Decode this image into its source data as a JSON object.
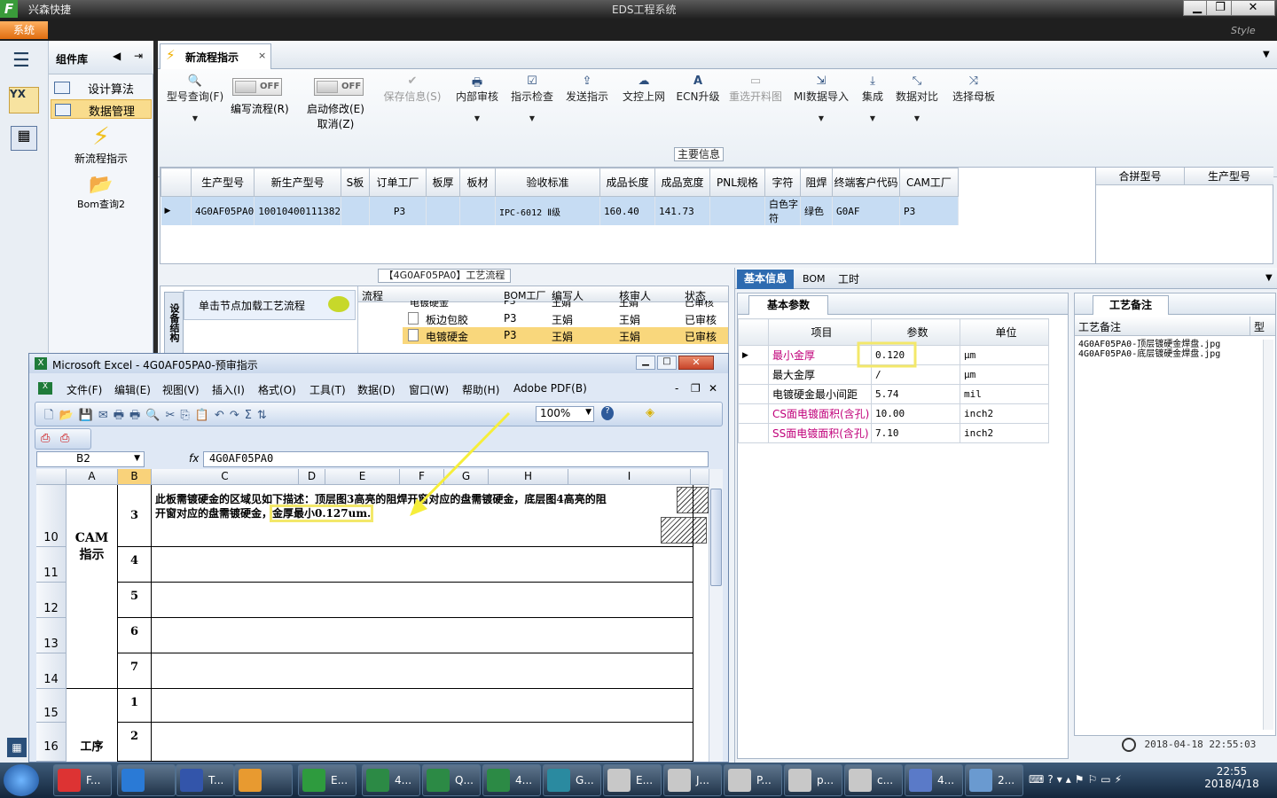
{
  "window": {
    "app_name": "兴森快捷",
    "title": "EDS工程系统",
    "system_label": "系统",
    "style_label": "Style"
  },
  "sidebar": {
    "header": "组件库",
    "items": [
      {
        "label": "设计算法"
      },
      {
        "label": "数据管理"
      }
    ],
    "big_items": [
      {
        "label": "新流程指示"
      },
      {
        "label": "Bom查询2"
      }
    ]
  },
  "tabs": [
    {
      "label": "新流程指示"
    }
  ],
  "ribbon": {
    "buttons": [
      {
        "label": "型号查询(F)",
        "icon": "search-icon"
      },
      {
        "label": "保存信息(S)",
        "icon": "check-icon",
        "disabled": true
      },
      {
        "label": "内部审核",
        "icon": "print-icon"
      },
      {
        "label": "指示检查",
        "icon": "checkbox-icon"
      },
      {
        "label": "发送指示",
        "icon": "upload-icon"
      },
      {
        "label": "文控上网",
        "icon": "cloud-upload-icon"
      },
      {
        "label": "ECN升级",
        "icon": "font-a-icon"
      },
      {
        "label": "重选开料图",
        "icon": "image-icon",
        "disabled": true
      },
      {
        "label": "MI数据导入",
        "icon": "import-icon"
      },
      {
        "label": "集成",
        "icon": "download-icon"
      },
      {
        "label": "数据对比",
        "icon": "compress-icon"
      },
      {
        "label": "选择母板",
        "icon": "random-icon"
      }
    ],
    "toggle1": {
      "label": "编写流程(R)",
      "state": "OFF"
    },
    "toggle2": {
      "label": "启动修改(E)",
      "sublabel": "取消(Z)",
      "state": "OFF"
    }
  },
  "main_info": {
    "title": "主要信息",
    "columns": [
      "生产型号",
      "新生产型号",
      "S板",
      "订单工厂",
      "板厚",
      "板材",
      "验收标准",
      "成品长度",
      "成品宽度",
      "PNL规格",
      "字符",
      "阻焊",
      "终端客户代码",
      "CAM工厂"
    ],
    "row": [
      "4G0AF05PA0",
      "10010400111382",
      "",
      "P3",
      "",
      "",
      "IPC-6012 Ⅱ级",
      "160.40",
      "141.73",
      "",
      "白色字符",
      "绿色",
      "G0AF",
      "P3"
    ],
    "right_columns": [
      "合拼型号",
      "生产型号"
    ]
  },
  "process": {
    "title": "【4G0AF05PA0】工艺流程",
    "side_tab": "设备结构",
    "load_label": "单击节点加载工艺流程",
    "columns": [
      "流程",
      "BOM工厂",
      "编写人",
      "核审人",
      "状态"
    ],
    "rows": [
      [
        "电镀硬金",
        "P3",
        "王娟",
        "王娟",
        "已审核"
      ],
      [
        "板边包胶",
        "P3",
        "王娟",
        "王娟",
        "已审核"
      ],
      [
        "电镀硬金",
        "P3",
        "王娟",
        "王娟",
        "已审核"
      ]
    ]
  },
  "detail": {
    "tabs": [
      "基本信息",
      "BOM",
      "工时"
    ],
    "param_tab": "基本参数",
    "columns": [
      "项目",
      "参数",
      "单位"
    ],
    "rows": [
      {
        "item": "最小金厚",
        "value": "0.120",
        "unit": "μm",
        "pink": true
      },
      {
        "item": "最大金厚",
        "value": "/",
        "unit": "μm",
        "pink": false
      },
      {
        "item": "电镀硬金最小间距",
        "value": "5.74",
        "unit": "mil",
        "pink": false
      },
      {
        "item": "CS面电镀面积(含孔)",
        "value": "10.00",
        "unit": "inch2",
        "pink": true
      },
      {
        "item": "SS面电镀面积(含孔)",
        "value": "7.10",
        "unit": "inch2",
        "pink": true
      }
    ],
    "notes_tab": "工艺备注",
    "notes_header": "工艺备注",
    "notes_header2": "型",
    "notes": [
      "4G0AF05PA0-顶层镀硬金焊盘.jpg",
      "4G0AF05PA0-底层镀硬金焊盘.jpg"
    ],
    "timestamp": "2018-04-18 22:55:03"
  },
  "excel": {
    "title": "Microsoft Excel - 4G0AF05PA0-预审指示",
    "menu": [
      "文件(F)",
      "编辑(E)",
      "视图(V)",
      "插入(I)",
      "格式(O)",
      "工具(T)",
      "数据(D)",
      "窗口(W)",
      "帮助(H)",
      "Adobe PDF(B)"
    ],
    "zoom": "100%",
    "name_box": "B2",
    "fx": "fx",
    "formula": "4G0AF05PA0",
    "columns": [
      "A",
      "B",
      "C",
      "D",
      "E",
      "F",
      "G",
      "H",
      "I"
    ],
    "rows": [
      "10",
      "11",
      "12",
      "13",
      "14",
      "15",
      "16"
    ],
    "cam_label": "CAM\n指示",
    "b_values": [
      "3",
      "4",
      "5",
      "6",
      "7",
      "1",
      "2"
    ],
    "next_label": "工序",
    "instruction_line1": "此板需镀硬金的区域见如下描述：顶层图3高亮的阻焊开窗对应的盘需镀硬金，底层图4高亮的阻",
    "instruction_line2": "开窗对应的盘需镀硬金，",
    "instruction_highlight": "金厚最小0.127um."
  },
  "taskbar": {
    "items": [
      "F...",
      "",
      "T...",
      "",
      "E...",
      "4...",
      "Q...",
      "4...",
      "G...",
      "E...",
      "J...",
      "P...",
      "p...",
      "c...",
      "4...",
      "2..."
    ],
    "time": "22:55",
    "date": "2018/4/18"
  }
}
